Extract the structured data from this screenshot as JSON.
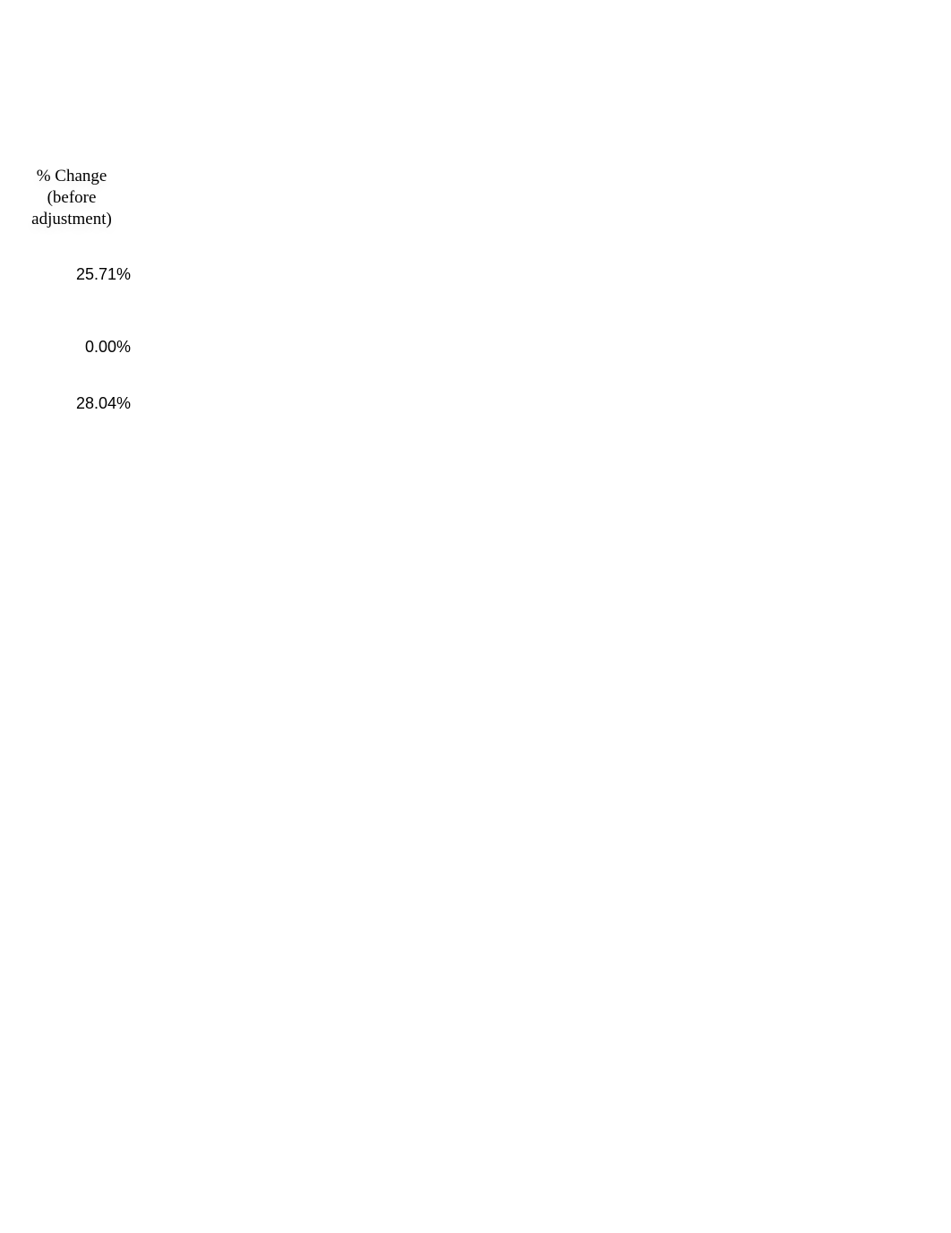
{
  "column": {
    "header_line1": "% Change",
    "header_line2": "(before",
    "header_line3": "adjustment)",
    "values": [
      "25.71%",
      "0.00%",
      "28.04%"
    ]
  }
}
